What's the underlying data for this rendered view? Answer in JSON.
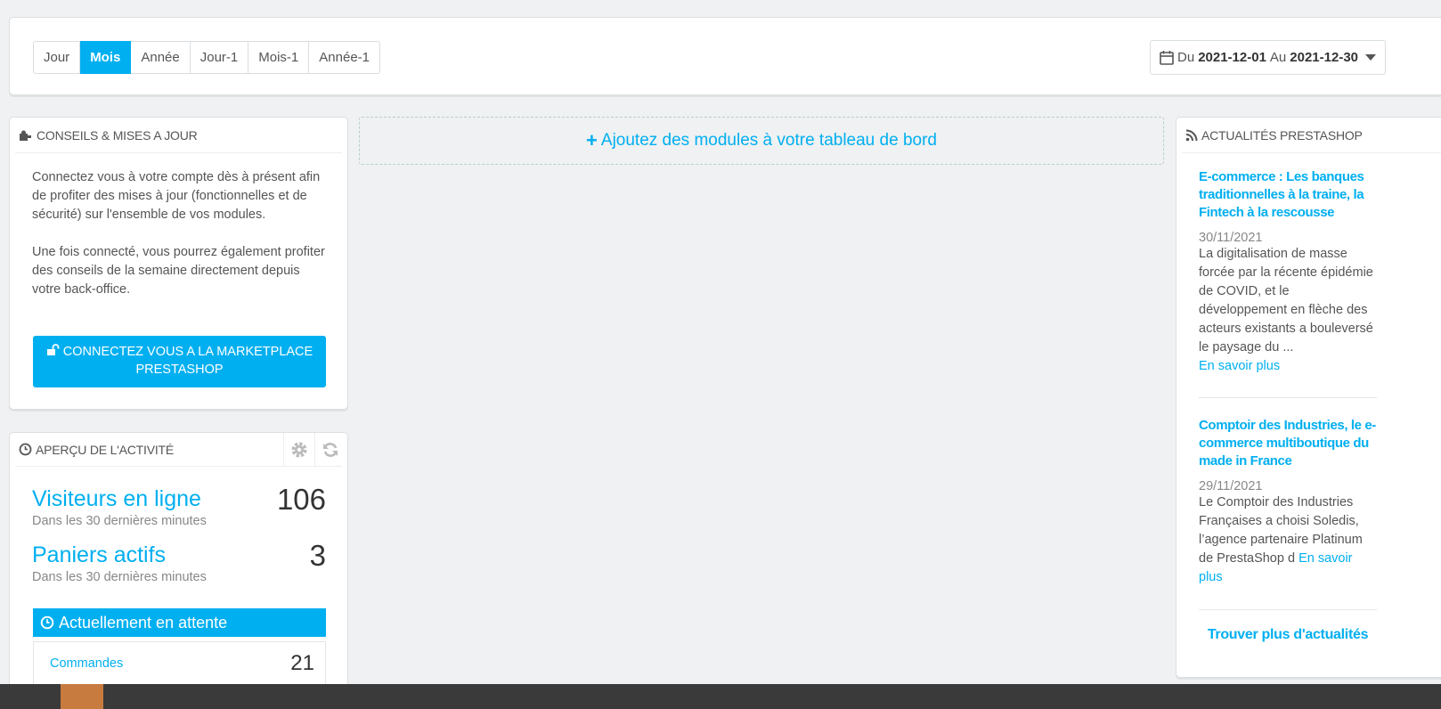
{
  "toolbar": {
    "periods": [
      {
        "label": "Jour",
        "active": false
      },
      {
        "label": "Mois",
        "active": true
      },
      {
        "label": "Année",
        "active": false
      },
      {
        "label": "Jour-1",
        "active": false
      },
      {
        "label": "Mois-1",
        "active": false
      },
      {
        "label": "Année-1",
        "active": false
      }
    ],
    "date_range": {
      "from_label": "Du",
      "from": "2021-12-01",
      "to_label": "Au",
      "to": "2021-12-30"
    }
  },
  "conseils": {
    "title": "CONSEILS & MISES A JOUR",
    "paragraph1": "Connectez vous à votre compte dès à présent afin de profiter des mises à jour (fonctionnelles et de sécurité) sur l'ensemble de vos modules.",
    "paragraph2": "Une fois connecté, vous pourrez également profiter des conseils de la semaine directement depuis votre back-office.",
    "button_line1": "CONNECTEZ VOUS A LA MARKETPLACE",
    "button_line2": "PRESTASHOP"
  },
  "add_modules": {
    "label": "Ajoutez des modules à votre tableau de bord"
  },
  "activity": {
    "title": "APERÇU DE L'ACTIVITÉ",
    "visitors": {
      "label": "Visiteurs en ligne",
      "sub": "Dans les 30 dernières minutes",
      "value": "106"
    },
    "carts": {
      "label": "Paniers actifs",
      "sub": "Dans les 30 dernières minutes",
      "value": "3"
    },
    "pending_title": "Actuellement en attente",
    "orders": {
      "label": "Commandes",
      "value": "21"
    }
  },
  "news": {
    "title": "ACTUALITÉS PRESTASHOP",
    "items": [
      {
        "title": "E-commerce : Les banques traditionnelles à la traine, la Fintech à la rescousse",
        "date": "30/11/2021",
        "text": "La digitalisation de masse forcée par la récente épidémie de COVID, et le développement en flèche des acteurs existants a bouleversé le paysage du ...",
        "link": "En savoir plus"
      },
      {
        "title": "Comptoir des Industries, le e-commerce multiboutique du made in France",
        "date": "29/11/2021",
        "text": "Le Comptoir des Industries Françaises a choisi Soledis, l’agence partenaire Platinum de PrestaShop d",
        "link": "En savoir plus"
      }
    ],
    "more": "Trouver plus d'actualités"
  },
  "colors": {
    "accent": "#00aff0",
    "text": "#555555",
    "muted": "#888888",
    "background": "#eff1f2"
  }
}
